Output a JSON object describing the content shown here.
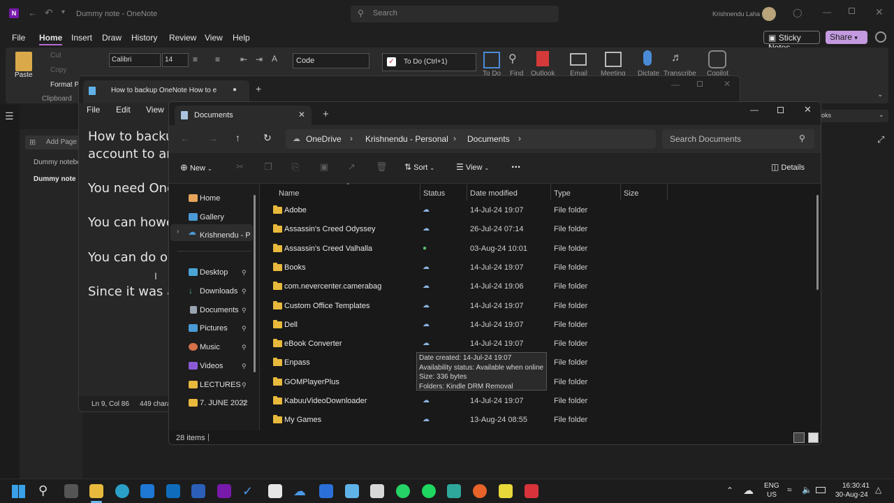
{
  "onenote": {
    "title": "Dummy note - OneNote",
    "search_placeholder": "Search",
    "user": "Krishnendu Laha",
    "menu": [
      "File",
      "Home",
      "Insert",
      "Draw",
      "History",
      "Review",
      "View",
      "Help"
    ],
    "sticky_notes": "Sticky Notes",
    "share": "Share",
    "clipboard": {
      "paste": "Paste",
      "cut": "Cut",
      "copy": "Copy",
      "format_painter": "Format P",
      "group": "Clipboard"
    },
    "font_name": "Calibri",
    "font_size": "14",
    "style_box": "Code",
    "todo_tag": "To Do (Ctrl+1)",
    "ribbon_labels": [
      "To Do",
      "Find",
      "Outlook",
      "Email",
      "Meeting",
      "Dictate",
      "Transcribe",
      "Copilot"
    ],
    "add_page": "Add Page",
    "pages": [
      "Dummy notebo",
      "Dummy note"
    ],
    "right_dropdown": "oks"
  },
  "notepad": {
    "tab_title": "How to backup OneNote  How to e",
    "menu": [
      "File",
      "Edit",
      "View"
    ],
    "lines": [
      "How to backup",
      "account to ano",
      "You need One",
      "You can howe",
      "You can do on",
      "Since it was a"
    ],
    "status_pos": "Ln 9, Col 86",
    "status_chars": "449 chara"
  },
  "explorer": {
    "tab_title": "Documents",
    "breadcrumb": [
      "OneDrive",
      "Krishnendu - Personal",
      "Documents"
    ],
    "search_placeholder": "Search Documents",
    "cmd": {
      "new": "New",
      "sort": "Sort",
      "view": "View",
      "more": "...",
      "details": "Details"
    },
    "nav": {
      "home": "Home",
      "gallery": "Gallery",
      "onedrive": "Krishnendu - Per",
      "desktop": "Desktop",
      "downloads": "Downloads",
      "documents": "Documents",
      "pictures": "Pictures",
      "music": "Music",
      "videos": "Videos",
      "lectures": "LECTURES",
      "june": "7. JUNE 2022"
    },
    "columns": [
      "Name",
      "Status",
      "Date modified",
      "Type",
      "Size"
    ],
    "rows": [
      {
        "name": "Adobe",
        "status": "cloud",
        "date": "14-Jul-24 19:07",
        "type": "File folder"
      },
      {
        "name": "Assassin's Creed Odyssey",
        "status": "cloud",
        "date": "26-Jul-24 07:14",
        "type": "File folder"
      },
      {
        "name": "Assassin's Creed Valhalla",
        "status": "synced",
        "date": "03-Aug-24 10:01",
        "type": "File folder"
      },
      {
        "name": "Books",
        "status": "cloud",
        "date": "14-Jul-24 19:07",
        "type": "File folder"
      },
      {
        "name": "com.nevercenter.camerabag",
        "status": "cloud",
        "date": "14-Jul-24 19:06",
        "type": "File folder"
      },
      {
        "name": "Custom Office Templates",
        "status": "cloud",
        "date": "14-Jul-24 19:07",
        "type": "File folder"
      },
      {
        "name": "Dell",
        "status": "cloud",
        "date": "14-Jul-24 19:07",
        "type": "File folder"
      },
      {
        "name": "eBook Converter",
        "status": "cloud",
        "date": "14-Jul-24 19:07",
        "type": "File folder"
      },
      {
        "name": "Enpass",
        "status": "cloud",
        "date": "",
        "type": "File folder"
      },
      {
        "name": "GOMPlayerPlus",
        "status": "",
        "date": "",
        "type": "File folder"
      },
      {
        "name": "KabuuVideoDownloader",
        "status": "cloud",
        "date": "14-Jul-24 19:07",
        "type": "File folder"
      },
      {
        "name": "My Games",
        "status": "cloud",
        "date": "13-Aug-24 08:55",
        "type": "File folder"
      }
    ],
    "status_count": "28 items",
    "tooltip": [
      "Date created: 14-Jul-24 19:07",
      "Availability status: Available when online",
      "Size: 336 bytes",
      "Folders: Kindle DRM Removal"
    ]
  },
  "taskbar": {
    "lang": "ENG",
    "region": "US",
    "time": "16:30:41",
    "date": "30-Aug-24"
  }
}
